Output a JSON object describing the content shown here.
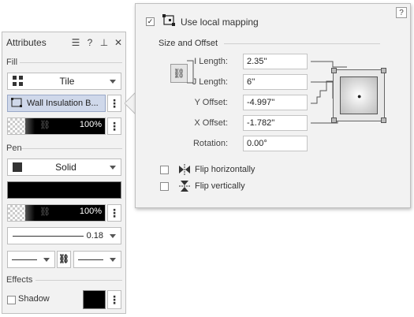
{
  "attributes_panel": {
    "title": "Attributes",
    "header_buttons": {
      "menu": "☰",
      "help": "?",
      "pin": "⊥",
      "close": "✕"
    },
    "fill": {
      "section_label": "Fill",
      "type_label": "Tile",
      "hatch_label": "Wall Insulation B...",
      "opacity": "100%"
    },
    "pen": {
      "section_label": "Pen",
      "style_label": "Solid",
      "opacity": "100%",
      "weight": "0.18"
    },
    "effects": {
      "section_label": "Effects",
      "shadow_label": "Shadow"
    }
  },
  "mapping_popover": {
    "help": "?",
    "use_local_mapping_label": "Use local mapping",
    "use_local_mapping_checked": true,
    "size_offset_label": "Size and Offset",
    "fields": [
      {
        "label": "I Length:",
        "value": "2.35''"
      },
      {
        "label": "J Length:",
        "value": "6''"
      },
      {
        "label": "Y Offset:",
        "value": "-4.997''"
      },
      {
        "label": "X Offset:",
        "value": "-1.782''"
      },
      {
        "label": "Rotation:",
        "value": "0.00°"
      }
    ],
    "flip_horizontal_label": "Flip horizontally",
    "flip_vertical_label": "Flip vertically"
  },
  "colors": {
    "panel_bg": "#f2f2f2",
    "selection_bg": "#cfd8ea",
    "border": "#bfbfbf"
  }
}
